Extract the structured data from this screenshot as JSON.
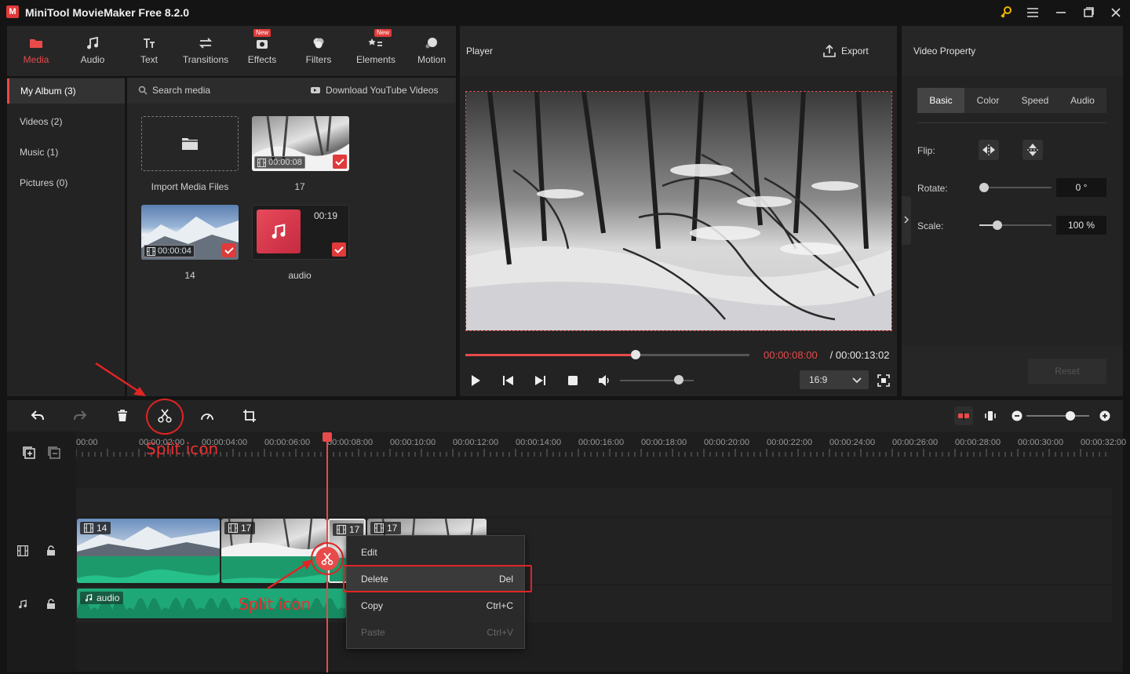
{
  "app": {
    "title": "MiniTool MovieMaker Free 8.2.0",
    "logo_letter": "M"
  },
  "nav_tabs": [
    {
      "label": "Media",
      "icon": "media-icon",
      "active": true,
      "badge": ""
    },
    {
      "label": "Audio",
      "icon": "music-note-icon",
      "active": false,
      "badge": ""
    },
    {
      "label": "Text",
      "icon": "text-icon",
      "active": false,
      "badge": ""
    },
    {
      "label": "Transitions",
      "icon": "transitions-icon",
      "active": false,
      "badge": ""
    },
    {
      "label": "Effects",
      "icon": "effects-icon",
      "active": false,
      "badge": "New"
    },
    {
      "label": "Filters",
      "icon": "filters-icon",
      "active": false,
      "badge": ""
    },
    {
      "label": "Elements",
      "icon": "elements-icon",
      "active": false,
      "badge": "New"
    },
    {
      "label": "Motion",
      "icon": "motion-icon",
      "active": false,
      "badge": ""
    }
  ],
  "album": {
    "items": [
      {
        "label": "My Album (3)",
        "active": true
      },
      {
        "label": "Videos (2)",
        "active": false
      },
      {
        "label": "Music (1)",
        "active": false
      },
      {
        "label": "Pictures (0)",
        "active": false
      }
    ]
  },
  "media": {
    "search_label": "Search media",
    "download_label": "Download YouTube Videos",
    "import_label": "Import Media Files",
    "items": [
      {
        "name": "17",
        "duration": "00:00:08"
      },
      {
        "name": "14",
        "duration": "00:00:04"
      },
      {
        "name": "audio",
        "duration": "00:19"
      }
    ]
  },
  "player": {
    "title": "Player",
    "export_label": "Export",
    "current_time": "00:00:08:00",
    "separator": " / ",
    "total_time": "00:00:13:02",
    "progress": 0.6,
    "volume": 0.8,
    "aspect_ratio": "16:9"
  },
  "property": {
    "title": "Video Property",
    "tabs": [
      "Basic",
      "Color",
      "Speed",
      "Audio"
    ],
    "active_tab": "Basic",
    "flip_label": "Flip:",
    "rotate_label": "Rotate:",
    "rotate_value": "0 °",
    "rotate_level": 0.0,
    "scale_label": "Scale:",
    "scale_value": "100 %",
    "scale_level": 0.25,
    "reset_label": "Reset"
  },
  "timeline": {
    "ruler": [
      "00:00",
      "00:00:02:00",
      "00:00:04:00",
      "00:00:06:00",
      "00:00:08:00",
      "00:00:10:00",
      "00:00:12:00",
      "00:00:14:00",
      "00:00:16:00",
      "00:00:18:00",
      "00:00:20:00",
      "00:00:22:00",
      "00:00:24:00",
      "00:00:26:00",
      "00:00:28:00",
      "00:00:30:00",
      "00:00:32:00"
    ],
    "clips": [
      {
        "label": "14"
      },
      {
        "label": "17"
      },
      {
        "label": "17"
      },
      {
        "label": "17"
      }
    ],
    "audio_clip": "audio",
    "zoom_level": 0.7
  },
  "context_menu": {
    "items": [
      {
        "label": "Edit",
        "shortcut": "",
        "disabled": false
      },
      {
        "label": "Delete",
        "shortcut": "Del",
        "disabled": false
      },
      {
        "label": "Copy",
        "shortcut": "Ctrl+C",
        "disabled": false
      },
      {
        "label": "Paste",
        "shortcut": "Ctrl+V",
        "disabled": true
      }
    ]
  },
  "annotations": {
    "split_label_1": "Split icon",
    "split_label_2": "Split icon"
  },
  "colors": {
    "accent": "#e84a4a",
    "audio_track": "#1fa877",
    "background": "#141414",
    "panel": "#232323"
  }
}
